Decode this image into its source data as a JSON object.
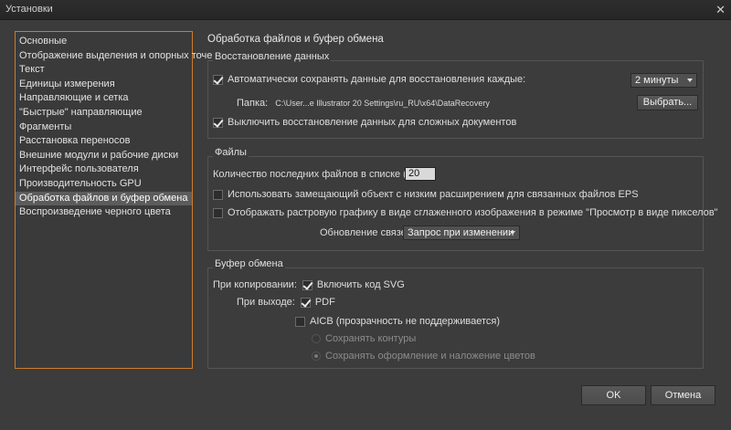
{
  "window": {
    "title": "Установки",
    "close_glyph": "✕"
  },
  "sidebar": {
    "items": [
      {
        "label": "Основные"
      },
      {
        "label": "Отображение выделения и опорных точек"
      },
      {
        "label": "Текст"
      },
      {
        "label": "Единицы измерения"
      },
      {
        "label": "Направляющие и сетка"
      },
      {
        "label": "\"Быстрые\" направляющие"
      },
      {
        "label": "Фрагменты"
      },
      {
        "label": "Расстановка переносов"
      },
      {
        "label": "Внешние модули и рабочие диски"
      },
      {
        "label": "Интерфейс пользователя"
      },
      {
        "label": "Производительность GPU"
      },
      {
        "label": "Обработка файлов и буфер обмена"
      },
      {
        "label": "Воспроизведение черного цвета"
      }
    ],
    "active_index": 11
  },
  "panel": {
    "title": "Обработка файлов и буфер обмена"
  },
  "recovery": {
    "group_title": "Восстановление данных",
    "autosave_label": "Автоматически сохранять данные для восстановления каждые:",
    "autosave_checked": true,
    "interval_value": "2 минуты",
    "folder_label": "Папка:",
    "folder_path": "C:\\User...e Illustrator 20 Settings\\ru_RU\\x64\\DataRecovery",
    "choose_button": "Выбрать...",
    "disable_complex_label": "Выключить восстановление данных для сложных документов",
    "disable_complex_checked": true
  },
  "files": {
    "group_title": "Файлы",
    "recent_label": "Количество последних файлов в списке (0-30):",
    "recent_value": "20",
    "proxy_label": "Использовать замещающий объект с низким расширением для связанных файлов EPS",
    "proxy_checked": false,
    "raster_label": "Отображать растровую графику в виде сглаженного изображения в режиме \"Просмотр в виде пикселов\"",
    "raster_checked": false,
    "update_links_label": "Обновление связей:",
    "update_links_value": "Запрос при изменении"
  },
  "clipboard": {
    "group_title": "Буфер обмена",
    "on_copy_label": "При копировании:",
    "svg_label": "Включить код SVG",
    "svg_checked": true,
    "on_exit_label": "При выходе:",
    "pdf_label": "PDF",
    "pdf_checked": true,
    "aicb_label": "AICB (прозрачность не поддерживается)",
    "aicb_checked": false,
    "preserve_paths_label": "Сохранять контуры",
    "preserve_appearance_label": "Сохранять оформление и наложение цветов",
    "preserve_selected": "appearance"
  },
  "footer": {
    "ok_label": "OK",
    "cancel_label": "Отмена"
  },
  "colors": {
    "accent": "#d07a2a",
    "background": "#3c3c3c",
    "active_item": "#5c5c5c"
  }
}
